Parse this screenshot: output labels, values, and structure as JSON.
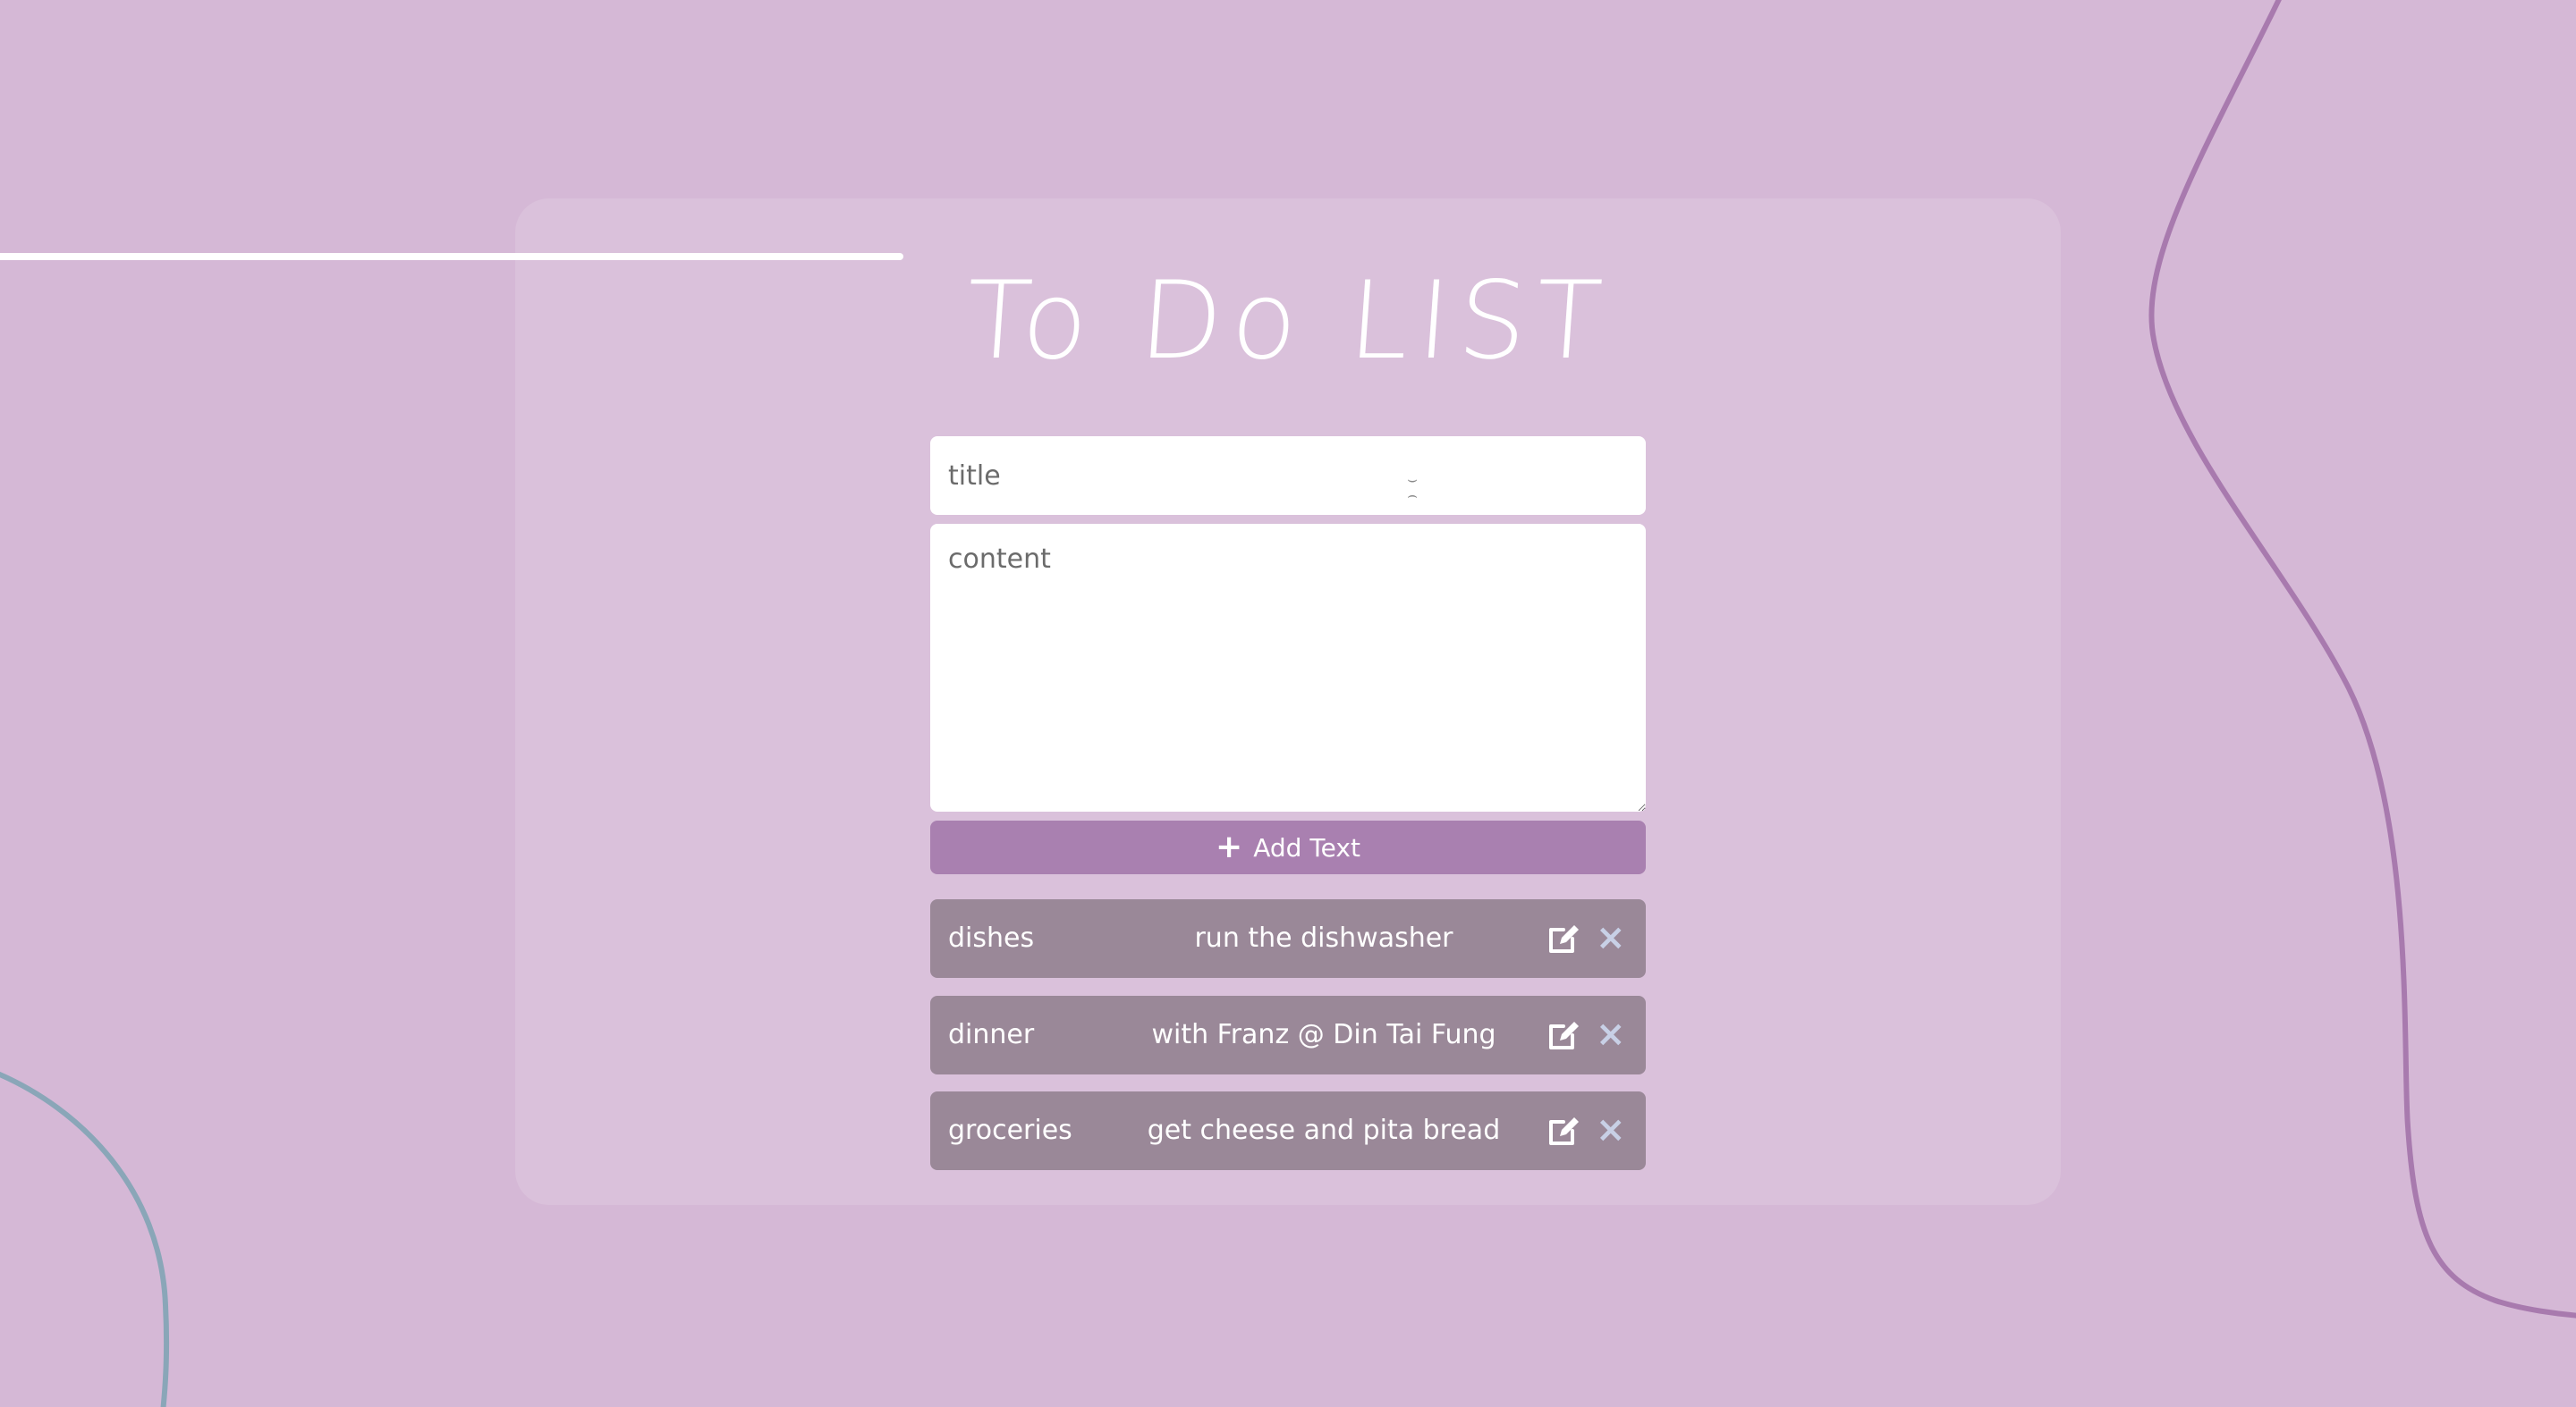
{
  "app": {
    "title": "To Do LIST"
  },
  "form": {
    "title_placeholder": "title",
    "content_placeholder": "content",
    "add_button_label": "Add Text",
    "add_button_icon": "plus-icon"
  },
  "items": [
    {
      "title": "dishes",
      "content": "run the dishwasher"
    },
    {
      "title": "dinner",
      "content": "with Franz @ Din Tai Fung"
    },
    {
      "title": "groceries",
      "content": "get cheese and pita bread"
    }
  ],
  "icons": {
    "edit": "edit-icon",
    "delete": "close-icon"
  },
  "colors": {
    "background": "#d5b8d6",
    "card": "#d9bfdc",
    "accent": "#a980b0",
    "item": "#9a8898",
    "delete_icon": "#c8d0e6",
    "deco_purple": "#a87aae",
    "deco_blue": "#8aa6b8"
  }
}
